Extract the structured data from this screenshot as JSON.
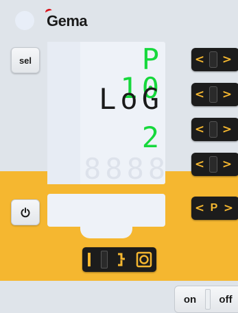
{
  "header": {
    "brand": "Gema",
    "status_led": "status-led"
  },
  "left_buttons": {
    "sel_label": "sel",
    "power_icon": "power-icon"
  },
  "display": {
    "program": "P 10",
    "mode": "LoG",
    "value": "2",
    "ghost": "8888"
  },
  "arrow_buttons": [
    {
      "left": "<",
      "right": ">"
    },
    {
      "left": "<",
      "right": ">"
    },
    {
      "left": "<",
      "right": ">"
    },
    {
      "left": "<",
      "right": ">"
    }
  ],
  "program_button": {
    "left": "<",
    "label": "P",
    "right": ">"
  },
  "mode_selector": {
    "icons": [
      "manual-mode-icon",
      "flow-mode-icon",
      "target-mode-icon"
    ]
  },
  "power_switch": {
    "on_label": "on",
    "off_label": "off"
  },
  "colors": {
    "accent_yellow": "#f5b730",
    "segment_green": "#16d83c",
    "brand_red": "#d8141c"
  }
}
